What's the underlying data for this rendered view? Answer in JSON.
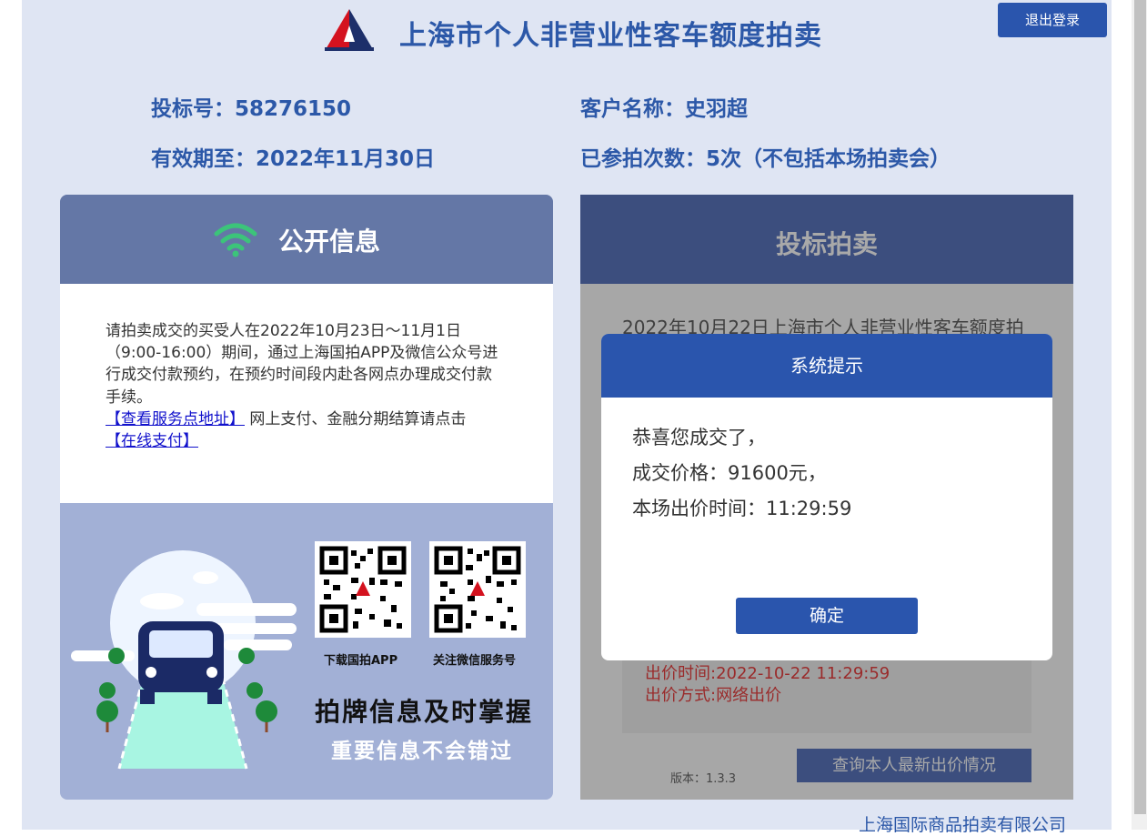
{
  "header": {
    "title": "上海市个人非营业性客车额度拍卖",
    "logout_label": "退出登录"
  },
  "account": {
    "bid_number": "投标号：58276150",
    "customer_name": "客户名称：史羽超",
    "valid_until": "有效期至：2022年11月30日",
    "participation_count": "已参拍次数：5次（不包括本场拍卖会）"
  },
  "public_info": {
    "title": "公开信息",
    "notice_text": "请拍卖成交的买受人在2022年10月23日～11月1日（9:00-16:00）期间，通过上海国拍APP及微信公众号进行成交付款预约，在预约时间段内赴各网点办理成交付款手续。",
    "service_link": "【查看服务点地址】",
    "online_text": " 网上支付、金融分期结算请点击",
    "pay_link": "【在线支付】",
    "qr_app_label": "下载国拍APP",
    "qr_wechat_label": "关注微信服务号",
    "slogan_main": "拍牌信息及时掌握",
    "slogan_sub": "重要信息不会错过"
  },
  "bidding": {
    "title": "投标拍卖",
    "auction_title": "2022年10月22日上海市个人非营业性客车额度拍",
    "bid_time": "出价时间:2022-10-22 11:29:59",
    "bid_method": "出价方式:网络出价",
    "version": "版本：1.3.3",
    "query_button": "查询本人最新出价情况"
  },
  "dialog": {
    "title": "系统提示",
    "line1": "恭喜您成交了，",
    "line2": "成交价格：91600元，",
    "line3": "本场出价时间：11:29:59",
    "ok_label": "确定"
  },
  "footer": {
    "company": "上海国际商品拍卖有限公司"
  },
  "colors": {
    "brand_blue": "#2a55ad",
    "title_blue": "#2c58a8",
    "page_bg": "#dfe5f3",
    "wifi_green": "#3cc47a"
  }
}
